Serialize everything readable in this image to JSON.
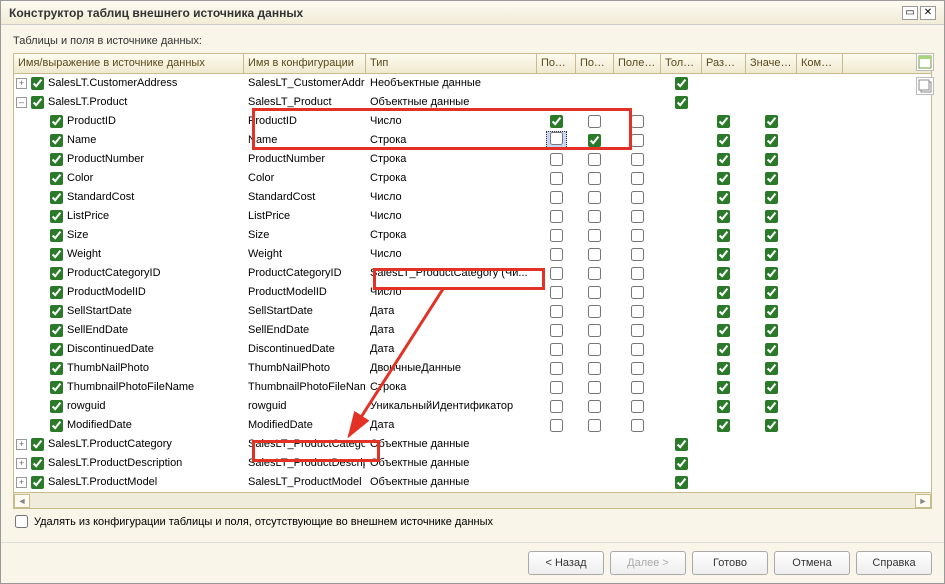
{
  "window": {
    "title": "Конструктор таблиц внешнего источника данных",
    "subtitle": "Таблицы и поля в источнике данных:"
  },
  "columns": {
    "name": "Имя/выражение в источнике данных",
    "config": "Имя в конфигурации",
    "type": "Тип",
    "key": "Поле ...",
    "pres": "Поле...",
    "presv": "Поле в...",
    "read": "Тольк...",
    "allow": "Разре...",
    "fill": "Значени...",
    "comm": "Комме..."
  },
  "rows": [
    {
      "lvl": 0,
      "exp": "+",
      "chk": true,
      "name": "SalesLT.CustomerAddress",
      "config": "SalesLT_CustomerAddress",
      "type": "Необъектные данные",
      "re": true
    },
    {
      "lvl": 0,
      "exp": "-",
      "chk": true,
      "name": "SalesLT.Product",
      "config": "SalesLT_Product",
      "type": "Объектные данные",
      "re": true
    },
    {
      "lvl": 1,
      "chk": true,
      "name": "ProductID",
      "config": "ProductID",
      "type": "Число",
      "k": true,
      "p": false,
      "pv": false,
      "ra": true,
      "zn": true
    },
    {
      "lvl": 1,
      "chk": true,
      "name": "Name",
      "config": "Name",
      "type": "Строка",
      "k": false,
      "p": true,
      "pv": false,
      "ra": true,
      "zn": true,
      "ksel": true
    },
    {
      "lvl": 1,
      "chk": true,
      "name": "ProductNumber",
      "config": "ProductNumber",
      "type": "Строка",
      "k": false,
      "p": false,
      "pv": false,
      "ra": true,
      "zn": true
    },
    {
      "lvl": 1,
      "chk": true,
      "name": "Color",
      "config": "Color",
      "type": "Строка",
      "k": false,
      "p": false,
      "pv": false,
      "ra": true,
      "zn": true
    },
    {
      "lvl": 1,
      "chk": true,
      "name": "StandardCost",
      "config": "StandardCost",
      "type": "Число",
      "k": false,
      "p": false,
      "pv": false,
      "ra": true,
      "zn": true
    },
    {
      "lvl": 1,
      "chk": true,
      "name": "ListPrice",
      "config": "ListPrice",
      "type": "Число",
      "k": false,
      "p": false,
      "pv": false,
      "ra": true,
      "zn": true
    },
    {
      "lvl": 1,
      "chk": true,
      "name": "Size",
      "config": "Size",
      "type": "Строка",
      "k": false,
      "p": false,
      "pv": false,
      "ra": true,
      "zn": true
    },
    {
      "lvl": 1,
      "chk": true,
      "name": "Weight",
      "config": "Weight",
      "type": "Число",
      "k": false,
      "p": false,
      "pv": false,
      "ra": true,
      "zn": true
    },
    {
      "lvl": 1,
      "chk": true,
      "name": "ProductCategoryID",
      "config": "ProductCategoryID",
      "type": "SalesLT_ProductCategory (Чи...",
      "k": false,
      "p": false,
      "pv": false,
      "ra": true,
      "zn": true
    },
    {
      "lvl": 1,
      "chk": true,
      "name": "ProductModelID",
      "config": "ProductModelID",
      "type": "Число",
      "k": false,
      "p": false,
      "pv": false,
      "ra": true,
      "zn": true
    },
    {
      "lvl": 1,
      "chk": true,
      "name": "SellStartDate",
      "config": "SellStartDate",
      "type": "Дата",
      "k": false,
      "p": false,
      "pv": false,
      "ra": true,
      "zn": true
    },
    {
      "lvl": 1,
      "chk": true,
      "name": "SellEndDate",
      "config": "SellEndDate",
      "type": "Дата",
      "k": false,
      "p": false,
      "pv": false,
      "ra": true,
      "zn": true
    },
    {
      "lvl": 1,
      "chk": true,
      "name": "DiscontinuedDate",
      "config": "DiscontinuedDate",
      "type": "Дата",
      "k": false,
      "p": false,
      "pv": false,
      "ra": true,
      "zn": true
    },
    {
      "lvl": 1,
      "chk": true,
      "name": "ThumbNailPhoto",
      "config": "ThumbNailPhoto",
      "type": "ДвоичныеДанные",
      "k": false,
      "p": false,
      "pv": false,
      "ra": true,
      "zn": true
    },
    {
      "lvl": 1,
      "chk": true,
      "name": "ThumbnailPhotoFileName",
      "config": "ThumbnailPhotoFileName",
      "type": "Строка",
      "k": false,
      "p": false,
      "pv": false,
      "ra": true,
      "zn": true
    },
    {
      "lvl": 1,
      "chk": true,
      "name": "rowguid",
      "config": "rowguid",
      "type": "УникальныйИдентификатор",
      "k": false,
      "p": false,
      "pv": false,
      "ra": true,
      "zn": true
    },
    {
      "lvl": 1,
      "chk": true,
      "name": "ModifiedDate",
      "config": "ModifiedDate",
      "type": "Дата",
      "k": false,
      "p": false,
      "pv": false,
      "ra": true,
      "zn": true
    },
    {
      "lvl": 0,
      "exp": "+",
      "chk": true,
      "name": "SalesLT.ProductCategory",
      "config": "SalesLT_ProductCategory",
      "type": "Объектные данные",
      "re": true
    },
    {
      "lvl": 0,
      "exp": "+",
      "chk": true,
      "name": "SalesLT.ProductDescription",
      "config": "SalesLT_ProductDescription",
      "type": "Объектные данные",
      "re": true
    },
    {
      "lvl": 0,
      "exp": "+",
      "chk": true,
      "name": "SalesLT.ProductModel",
      "config": "SalesLT_ProductModel",
      "type": "Объектные данные",
      "re": true
    }
  ],
  "footer": {
    "delete_missing": "Удалять из конфигурации таблицы и поля, отсутствующие во внешнем источнике данных"
  },
  "buttons": {
    "back": "< Назад",
    "next": "Далее >",
    "finish": "Готово",
    "cancel": "Отмена",
    "help": "Справка"
  }
}
